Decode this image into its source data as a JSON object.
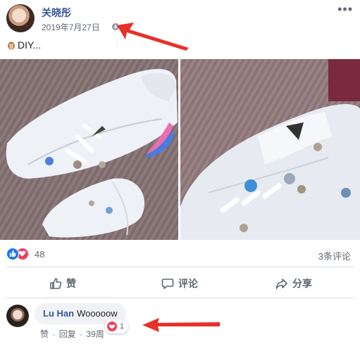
{
  "post": {
    "author": "关晓彤",
    "timestamp": "2019年7月27日",
    "text": "DIY...",
    "reactions_count": "48",
    "comments_count": "3条评论"
  },
  "actions": {
    "like": "赞",
    "comment": "评论",
    "share": "分享"
  },
  "comment": {
    "author": "Lu Han",
    "text": "Wooooow",
    "like_link": "赞",
    "reply_link": "回复",
    "age": "39周",
    "reaction_count": "1"
  },
  "colors": {
    "link_blue": "#385898",
    "like_blue": "#1877f2",
    "love_red": "#f33e58",
    "annotation_arrow": "#e8302a"
  },
  "icons": [
    "globe-icon",
    "more-icon",
    "like-reaction-icon",
    "love-reaction-icon",
    "thumbs-up-icon",
    "comment-icon",
    "share-icon"
  ]
}
